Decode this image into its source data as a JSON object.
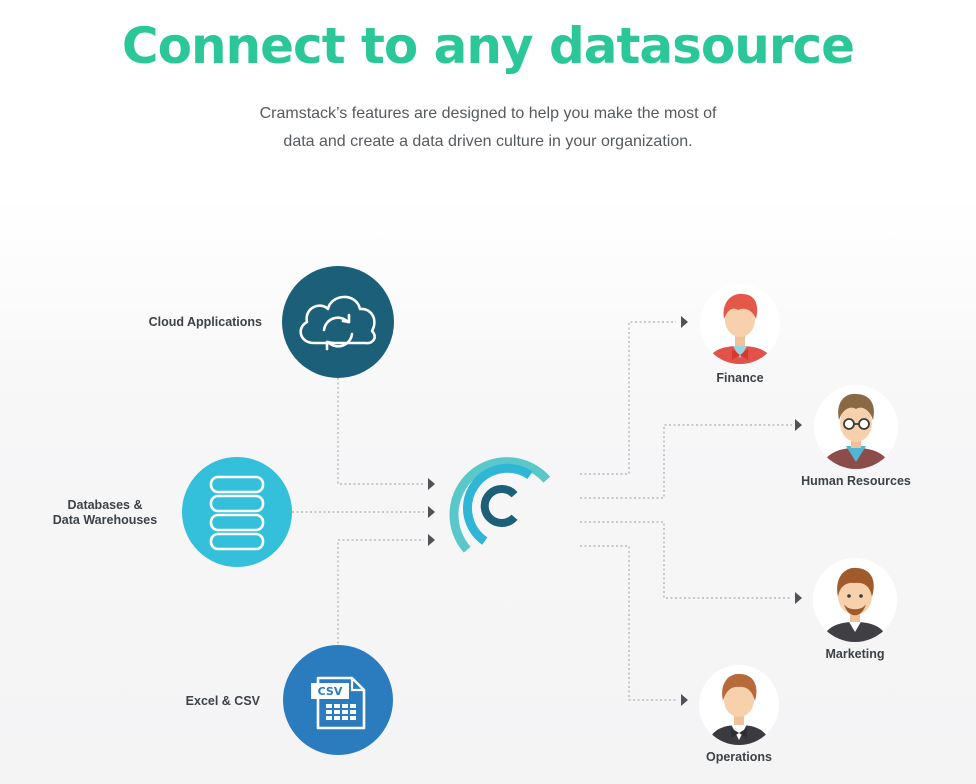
{
  "header": {
    "title": "Connect to any datasource",
    "subtitle_line1": "Cramstack’s features are designed to help you make the most of",
    "subtitle_line2": "data and create a data driven culture in your organization."
  },
  "sources": [
    {
      "label": "Cloud Applications",
      "icon": "cloud-sync-icon",
      "color": "#1c5f79"
    },
    {
      "label_line1": "Databases &",
      "label_line2": "Data Warehouses",
      "icon": "database-icon",
      "color": "#34bfdb"
    },
    {
      "label": "Excel & CSV",
      "icon": "csv-file-icon",
      "icon_text": "CSV",
      "color": "#2a7cbf"
    }
  ],
  "hub": {
    "icon": "cramstack-logo-icon",
    "arc_colors": [
      "#5ac8c8",
      "#2fb6d6",
      "#1c5f79"
    ]
  },
  "destinations": [
    {
      "label": "Finance",
      "icon": "finance-person-icon"
    },
    {
      "label": "Human Resources",
      "icon": "hr-person-icon"
    },
    {
      "label": "Marketing",
      "icon": "marketing-person-icon"
    },
    {
      "label": "Operations",
      "icon": "operations-person-icon"
    }
  ],
  "colors": {
    "title": "#2cc799",
    "connector": "#a9adb1",
    "arrow": "#4f5357"
  }
}
